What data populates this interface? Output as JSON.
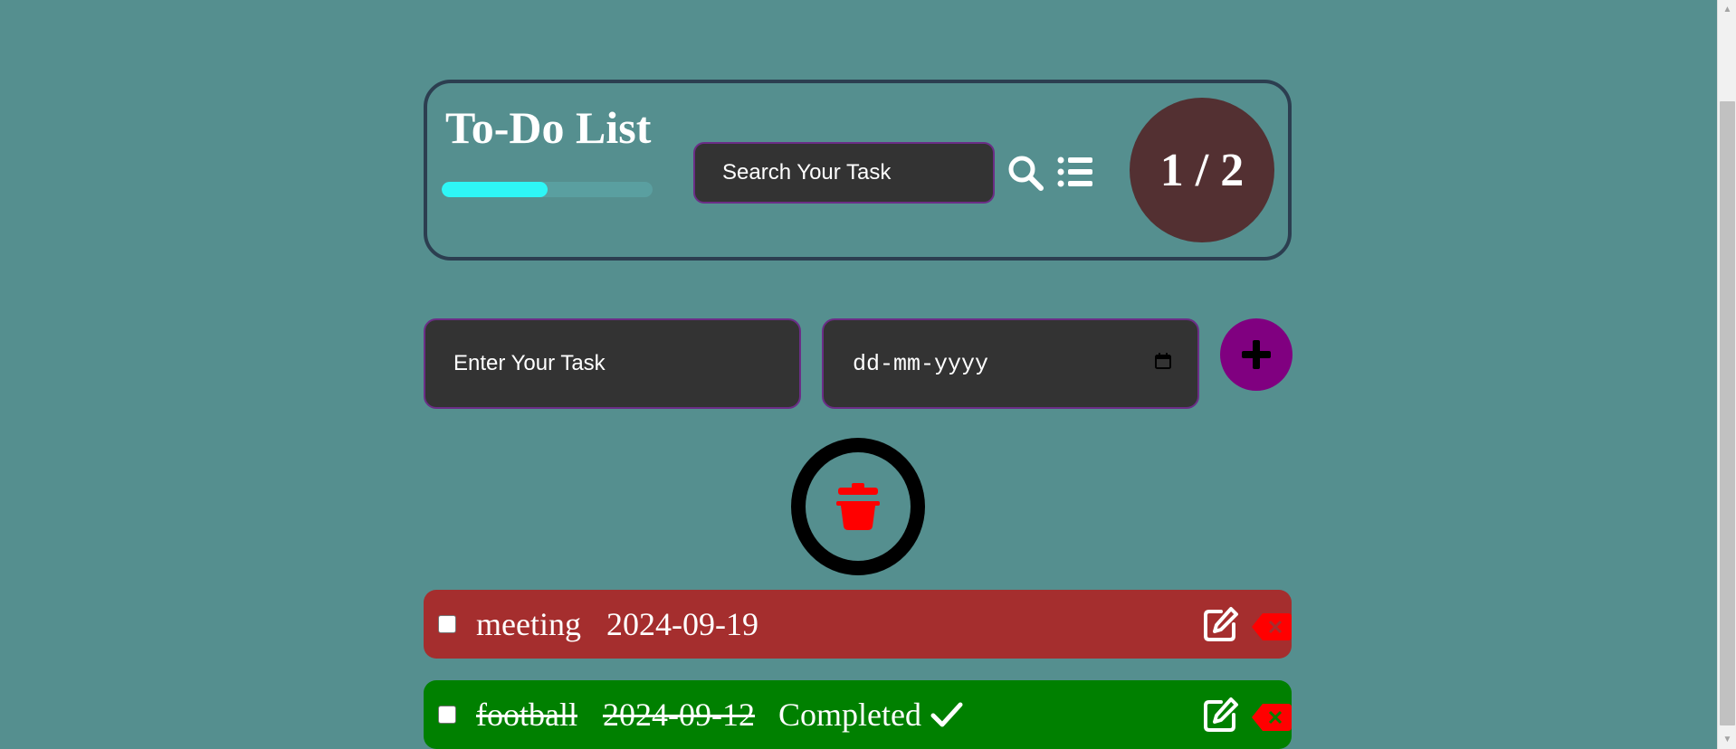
{
  "header": {
    "title": "To-Do List",
    "progress_fraction": 0.5,
    "search_placeholder": "Search Your Task",
    "search_icon": "search-icon",
    "list_icon": "list-icon",
    "counter": "1 / 2"
  },
  "form": {
    "task_placeholder": "Enter Your Task",
    "date_placeholder": "dd-mm-yyyy",
    "calendar_icon": "calendar-icon",
    "add_icon": "plus-icon"
  },
  "delete_all": {
    "icon": "trash-icon",
    "icon_color": "#ff0000"
  },
  "tasks": [
    {
      "name": "meeting",
      "date": "2024-09-19",
      "status": "",
      "completed": false,
      "color": "#a52e2e"
    },
    {
      "name": "football",
      "date": "2024-09-12",
      "status": "Completed",
      "completed": true,
      "color": "#008000"
    }
  ],
  "colors": {
    "background": "#558f8f",
    "progress": "#2ef6f6",
    "counter_bg": "#533032",
    "add_button": "#800080"
  }
}
